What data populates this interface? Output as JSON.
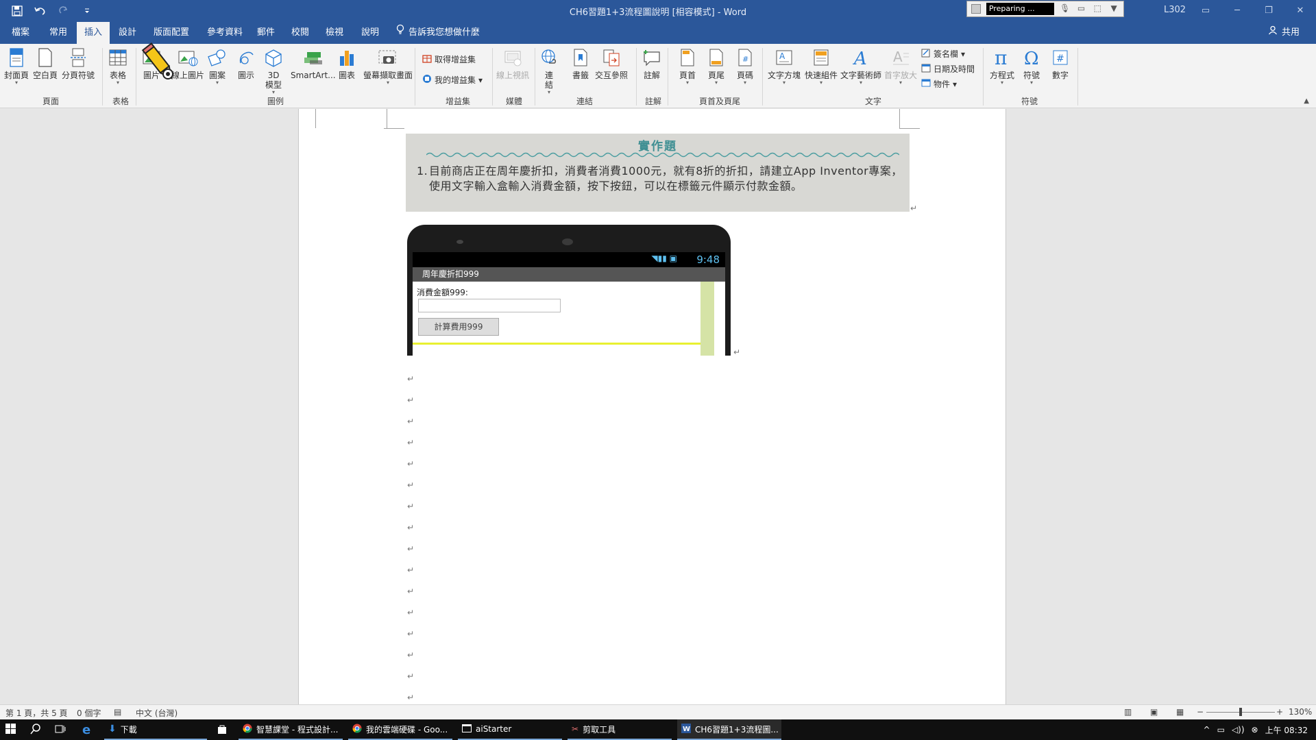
{
  "window": {
    "title": "CH6習題1+3流程圖說明 [相容模式] - Word",
    "user": "L302",
    "recorder_status": "Preparing ..."
  },
  "menu_tabs": [
    "檔案",
    "常用",
    "插入",
    "設計",
    "版面配置",
    "參考資料",
    "郵件",
    "校閱",
    "檢視",
    "說明"
  ],
  "active_tab": "插入",
  "tell_me": "告訴我您想做什麼",
  "share": "共用",
  "ribbon": {
    "groups": {
      "pages": "頁面",
      "tables": "表格",
      "illustrations": "圖例",
      "addins": "增益集",
      "media": "媒體",
      "links": "連結",
      "comments": "註解",
      "header_footer": "頁首及頁尾",
      "text": "文字",
      "symbols": "符號"
    },
    "buttons": {
      "cover_page": "封面頁",
      "blank_page": "空白頁",
      "page_break": "分頁符號",
      "table": "表格",
      "pictures": "圖片",
      "online_pictures": "線上圖片",
      "shapes": "圖案",
      "icons": "圖示",
      "models_3d": "3D 模型",
      "smartart": "SmartArt...",
      "chart": "圖表",
      "screenshot": "螢幕擷取畫面",
      "get_addins": "取得增益集",
      "my_addins": "我的增益集",
      "online_video": "線上視訊",
      "link": "連結",
      "bookmark": "書籤",
      "cross_reference": "交互參照",
      "comment": "註解",
      "header": "頁首",
      "footer": "頁尾",
      "page_number": "頁碼",
      "text_box": "文字方塊",
      "quick_parts": "快速組件",
      "wordart": "文字藝術師",
      "drop_cap": "首字放大",
      "signature_line": "簽名欄",
      "date_time": "日期及時間",
      "object": "物件",
      "equation": "方程式",
      "symbol": "符號",
      "number": "數字"
    }
  },
  "document": {
    "exercise_title": "實作題",
    "exercise_number": "1.",
    "exercise_text": "目前商店正在周年慶折扣，消費者消費1000元，就有8折的折扣，請建立App Inventor專案，使用文字輸入盒輸入消費金額，按下按鈕，可以在標籤元件顯示付款金額。",
    "phone": {
      "time": "9:48",
      "app_title": "周年慶折扣999",
      "amount_label": "消費金額999:",
      "calc_button": "計算費用999"
    },
    "paragraph_mark": "↵"
  },
  "statusbar": {
    "page": "第 1 頁，共 5 頁",
    "words": "0 個字",
    "language": "中文 (台灣)",
    "zoom": "130%"
  },
  "taskbar": {
    "download": "下載",
    "items": [
      "智慧課堂 - 程式設計...",
      "我的雲端硬碟 - Goo...",
      "aiStarter",
      "剪取工具",
      "CH6習題1+3流程圖..."
    ],
    "clock": "上午 08:32"
  }
}
